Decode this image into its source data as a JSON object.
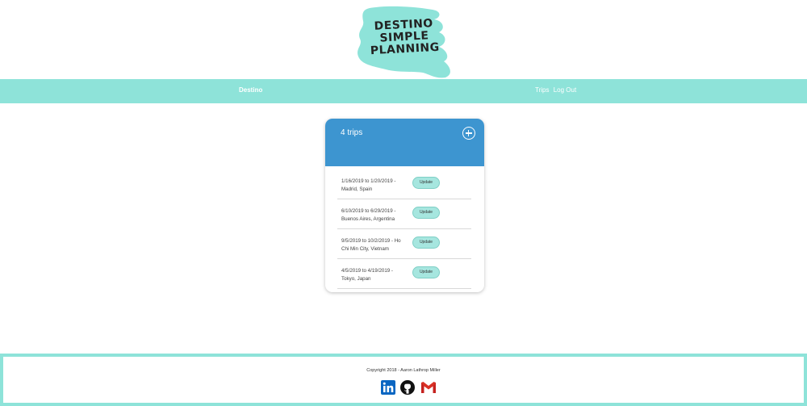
{
  "logo": {
    "lines": [
      "DESTINO",
      "SIMPLE",
      "PLANNING"
    ],
    "color": "#8ee3d9"
  },
  "nav": {
    "brand": "Destino",
    "links": [
      "Trips",
      "Log Out"
    ]
  },
  "card": {
    "title": "4 trips",
    "add_icon": "plus-circle-icon",
    "trips": [
      {
        "text": "1/16/2019 to 1/20/2019 - Madrid, Spain",
        "button": "Update"
      },
      {
        "text": "6/10/2019 to 6/29/2019 - Buenos Aires, Argentina",
        "button": "Update"
      },
      {
        "text": "9/5/2019 to 10/2/2019 - Ho Chi Min City, Vietnam",
        "button": "Update"
      },
      {
        "text": "4/5/2019 to 4/19/2019 - Tokyo, Japan",
        "button": "Update"
      }
    ]
  },
  "footer": {
    "copyright": "Copyright 2018 - Aaron Lathrop Miller",
    "icons": [
      "linkedin-icon",
      "github-icon",
      "gmail-icon"
    ]
  },
  "colors": {
    "accent": "#8ee3d9",
    "header_blue": "#3d95d0",
    "button": "#a6e6df"
  }
}
